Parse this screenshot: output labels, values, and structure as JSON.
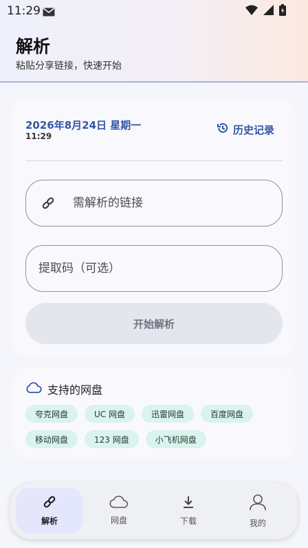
{
  "status_bar": {
    "time": "11:29"
  },
  "header": {
    "title": "解析",
    "subtitle": "粘贴分享链接，快速开始"
  },
  "parse_card": {
    "date": "2026年8月24日 星期一",
    "time": "11:29",
    "history_label": "历史记录",
    "link_placeholder": "需解析的链接",
    "code_placeholder": "提取码（可选）",
    "start_label": "开始解析"
  },
  "disks_card": {
    "title": "支持的网盘",
    "row1": [
      "夸克网盘",
      "UC 网盘",
      "迅雷网盘",
      "百度网盘"
    ],
    "row2": [
      "移动网盘",
      "123 网盘",
      "小飞机网盘"
    ]
  },
  "nav": {
    "items": [
      {
        "label": "解析",
        "icon": "link-icon"
      },
      {
        "label": "网盘",
        "icon": "cloud-icon"
      },
      {
        "label": "下载",
        "icon": "download-icon"
      },
      {
        "label": "我的",
        "icon": "person-icon"
      }
    ]
  },
  "colors": {
    "accent": "#3355a5",
    "chip_bg": "#daf3ec",
    "active_nav_bg": "#e4e6fb"
  }
}
